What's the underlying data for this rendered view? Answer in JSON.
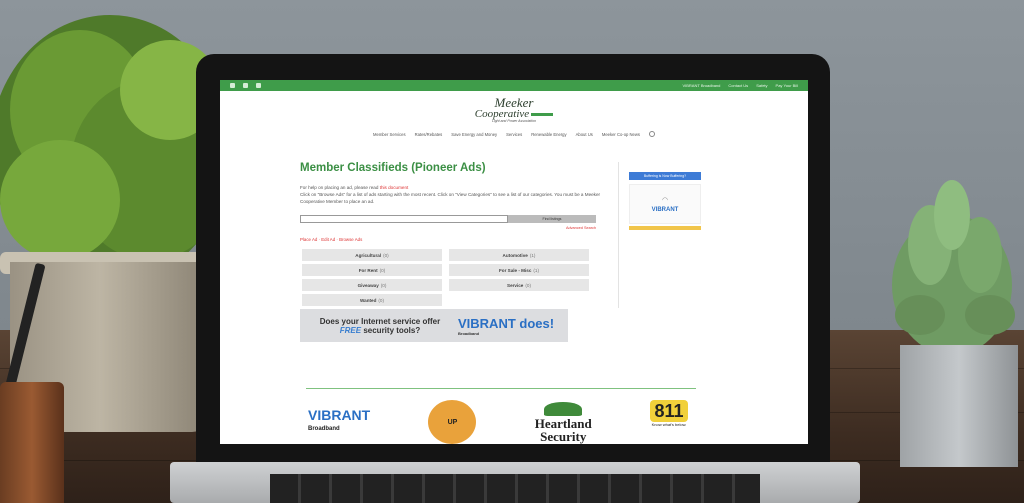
{
  "topbar": {
    "phone": "",
    "links": [
      "VIBRANT Broadband",
      "Contact Us",
      "Safety",
      "Pay Your Bill"
    ]
  },
  "logo": {
    "line1": "Meeker",
    "line2": "Cooperative",
    "tagline": "Light and Power Association"
  },
  "nav": {
    "items": [
      "Member Services",
      "Rates/Rebates",
      "Save Energy and Money",
      "Services",
      "Renewable Energy",
      "About Us",
      "Meeker Co-op News"
    ]
  },
  "main": {
    "title": "Member Classifieds (Pioneer Ads)",
    "help_text": "For help on placing an ad, please read",
    "help_link": "this document",
    "instructions": "Click on \"Browse Ads\" for a list of ads starting with the most recent. Click on \"View Categories\" to see a list of our categories. You must be a Meeker Cooperative Member to place an ad.",
    "search_button": "Find listings",
    "advanced_search": "Advanced Search",
    "tabs": [
      "Place Ad",
      "Edit Ad",
      "Browse Ads"
    ],
    "categories": [
      {
        "name": "Agricultural",
        "count": "(0)"
      },
      {
        "name": "Automotive",
        "count": "(1)"
      },
      {
        "name": "For Rent",
        "count": "(0)"
      },
      {
        "name": "For Sale - Misc",
        "count": "(1)"
      },
      {
        "name": "Giveaway",
        "count": "(0)"
      },
      {
        "name": "Service",
        "count": "(0)"
      },
      {
        "name": "Wanted",
        "count": "(0)"
      }
    ]
  },
  "banner": {
    "line1": "Does your Internet service offer",
    "free": "FREE",
    "line2": "security tools?",
    "brand": "VIBRANT",
    "brand_suffix": "does!",
    "brand_sub": "Broadband"
  },
  "sidebar": {
    "top_label": "Buffering is Now Buffering?",
    "brand": "VIBRANT"
  },
  "footer_logos": {
    "vibrant": "VIBRANT",
    "vibrant_sub": "Broadband",
    "roundup": "UP",
    "heartland": "Heartland",
    "heartland_sub": "Security",
    "n811": "811",
    "n811_sub": "Know what's below."
  },
  "colors": {
    "brand_green": "#3f9c4a",
    "link_red": "#dd3333",
    "vibrant_blue": "#2a6fc4"
  }
}
